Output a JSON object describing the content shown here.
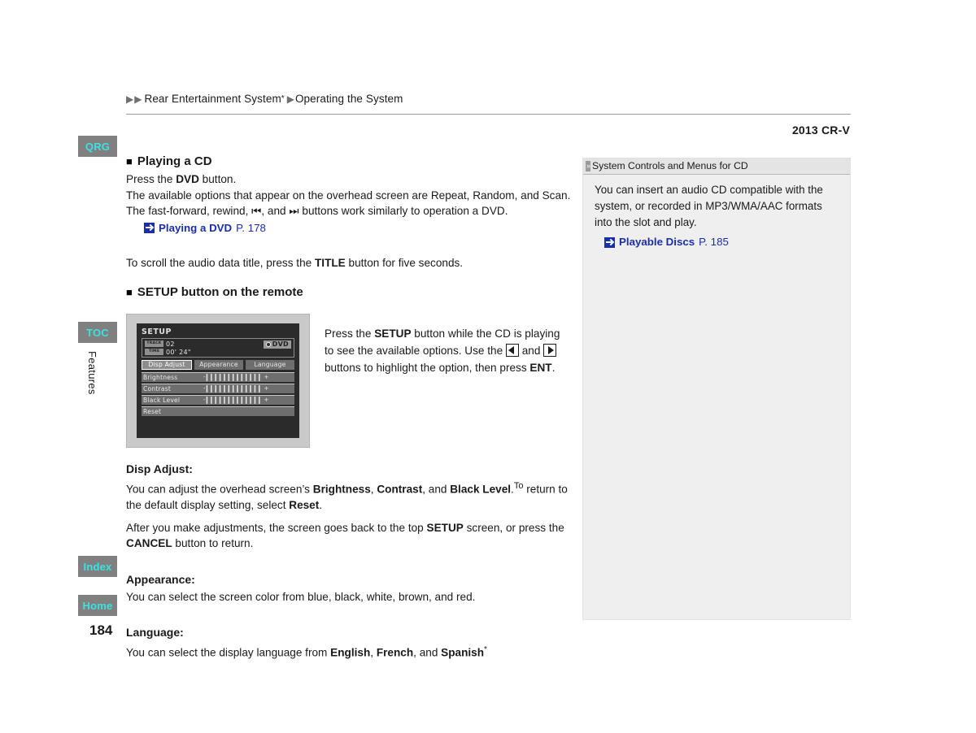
{
  "breadcrumb": {
    "level1": "Rear Entertainment System",
    "level1_mark": "*",
    "level2": "Operating the System"
  },
  "header": {
    "model": "2013 CR-V"
  },
  "sidebar": {
    "tabs": [
      {
        "label": "QRG"
      },
      {
        "label": "TOC"
      },
      {
        "label": "Index"
      },
      {
        "label": "Home"
      }
    ],
    "section_label": "Features",
    "page_number": "184"
  },
  "main": {
    "section1": {
      "heading": "Playing a CD",
      "line1_a": "Press the ",
      "line1_b": "DVD",
      "line1_c": " button.",
      "para_a": "The available options that appear on the overhead screen are Repeat, Random, and Scan. The fast-forward, rewind, ",
      "icon_prev": "⏮",
      "para_b": ", and ",
      "icon_next": "⏭",
      "para_c": " buttons work similarly to operation a DVD.",
      "link": {
        "label": "Playing a DVD",
        "page": "P. 178"
      },
      "scroll_a": "To scroll the audio data title, press the ",
      "scroll_b": "TITLE",
      "scroll_c": " button for five seconds."
    },
    "section2": {
      "heading": "SETUP button on the remote",
      "text_a": "Press the ",
      "text_b": "SETUP",
      "text_c": " button while the CD is playing to see the available options. Use the ",
      "text_d": " and ",
      "text_e": " buttons to highlight the option, then press ",
      "text_f": "ENT",
      "text_g": "."
    },
    "disp_adjust": {
      "heading": "Disp Adjust:",
      "p1_a": "You can adjust the overhead screen’s ",
      "p1_b": "Brightness",
      "p1_c": ", ",
      "p1_d": "Contrast",
      "p1_e": ", and ",
      "p1_f": "Black Level",
      "p1_g": ".",
      "p1_h": "To",
      "p1_i": " return to the default display setting, select ",
      "p1_j": "Reset",
      "p1_k": ".",
      "p2_a": "After you make adjustments, the screen goes back to the top ",
      "p2_b": "SETUP",
      "p2_c": " screen, or press the ",
      "p2_d": "CANCEL",
      "p2_e": " button to return."
    },
    "appearance": {
      "heading": "Appearance:",
      "text": "You can select the screen color from blue, black, white, brown, and red."
    },
    "language": {
      "heading": "Language:",
      "text_a": "You can select the display language from ",
      "text_b": "English",
      "text_c": ", ",
      "text_d": "French",
      "text_e": ", and ",
      "text_f": "Spanish",
      "text_g": "*"
    }
  },
  "setup_screen": {
    "title": "SETUP",
    "track_label": "TRACK",
    "track_value": "02",
    "time_label": "TIME",
    "time_value": "00' 24\"",
    "disc_badge": "DVD",
    "tabs": [
      {
        "label": "Disp Adjust",
        "active": true
      },
      {
        "label": "Appearance",
        "active": false
      },
      {
        "label": "Language",
        "active": false
      }
    ],
    "rows": [
      {
        "label": "Brightness",
        "minus": "-",
        "ticks": "▎▎▎▎▎▎▎▎▎▎▎▎▎",
        "plus": "+"
      },
      {
        "label": "Contrast",
        "minus": "-",
        "ticks": "▎▎▎▎▎▎▎▎▎▎▎▎▎",
        "plus": "+"
      },
      {
        "label": "Black Level",
        "minus": "-",
        "ticks": "▎▎▎▎▎▎▎▎▎▎▎▎▎",
        "plus": "+"
      },
      {
        "label": "Reset",
        "minus": "",
        "ticks": "",
        "plus": ""
      }
    ]
  },
  "note": {
    "title": "System Controls and Menus for CD",
    "body": "You can insert an audio CD compatible with the system, or recorded in MP3/WMA/AAC formats into the slot and play.",
    "link": {
      "label": "Playable Discs",
      "page": "P. 185"
    }
  },
  "colors": {
    "tab_bg": "#808080",
    "tab_text": "#3fe0e0",
    "link": "#1b2ea8",
    "note_bg": "#efefef"
  }
}
